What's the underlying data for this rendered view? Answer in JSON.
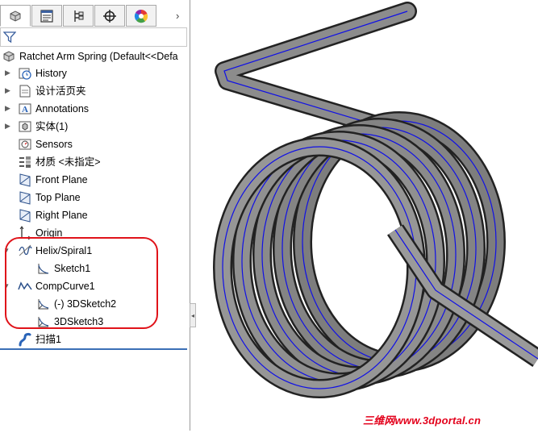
{
  "tabs": [
    {
      "name": "feature-manager-tab",
      "icon": "feature-manager-icon"
    },
    {
      "name": "property-manager-tab",
      "icon": "property-manager-icon"
    },
    {
      "name": "configuration-manager-tab",
      "icon": "configuration-manager-icon"
    },
    {
      "name": "dimxpert-manager-tab",
      "icon": "crosshair-icon"
    },
    {
      "name": "display-manager-tab",
      "icon": "color-wheel-icon"
    }
  ],
  "tab_more_arrow": "›",
  "filter": {
    "icon": "filter-icon"
  },
  "tree": {
    "root": "Ratchet Arm Spring  (Default<<Defa",
    "items": [
      {
        "label": "History",
        "icon": "history-icon"
      },
      {
        "label": "设计活页夹",
        "icon": "design-binder-icon"
      },
      {
        "label": "Annotations",
        "icon": "annotations-icon"
      },
      {
        "label": "实体(1)",
        "icon": "solid-bodies-icon"
      },
      {
        "label": "Sensors",
        "icon": "sensors-icon"
      },
      {
        "label": "材质 <未指定>",
        "icon": "material-icon"
      },
      {
        "label": "Front Plane",
        "icon": "plane-icon"
      },
      {
        "label": "Top Plane",
        "icon": "plane-icon"
      },
      {
        "label": "Right Plane",
        "icon": "plane-icon"
      },
      {
        "label": "Origin",
        "icon": "origin-icon"
      },
      {
        "label": "Helix/Spiral1",
        "icon": "helix-icon"
      },
      {
        "label": "Sketch1",
        "icon": "sketch-icon"
      },
      {
        "label": "CompCurve1",
        "icon": "composite-curve-icon"
      },
      {
        "label": "(-) 3DSketch2",
        "icon": "3dsketch-icon"
      },
      {
        "label": "3DSketch3",
        "icon": "3dsketch-icon"
      },
      {
        "label": "扫描1",
        "icon": "sweep-icon"
      }
    ]
  },
  "colors": {
    "annotation_ring": "#e0131a",
    "spring_body": "#7d7d7d",
    "centerline": "#1010e6",
    "active_line": "#3b6fb6"
  },
  "watermark": "三维网www.3dportal.cn"
}
